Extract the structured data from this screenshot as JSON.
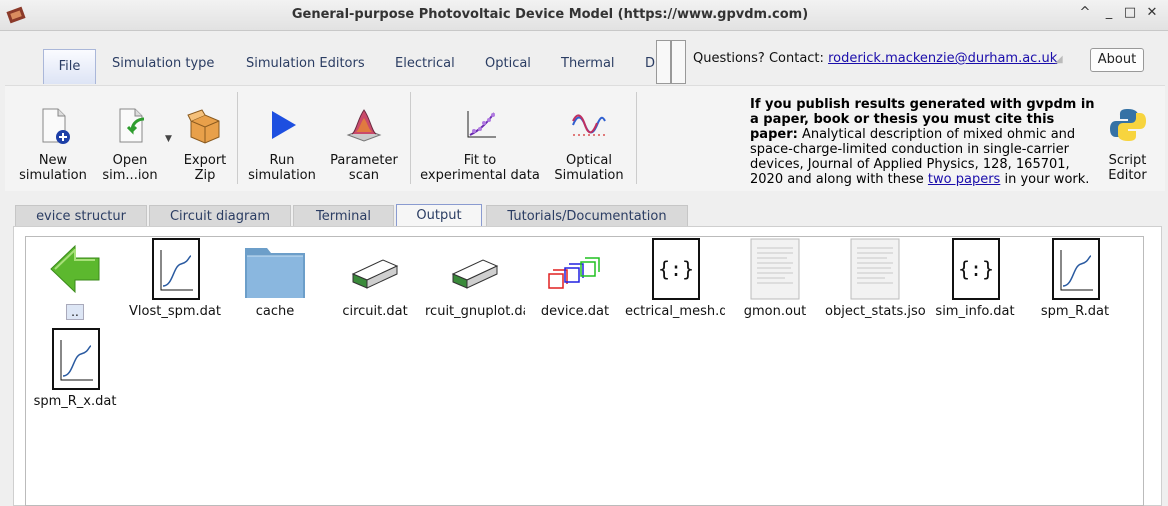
{
  "window": {
    "title": "General-purpose Photovoltaic Device Model (https://www.gpvdm.com)",
    "controls": [
      "^",
      "_",
      "□",
      "✕"
    ]
  },
  "ribbon_tabs": [
    "File",
    "Simulation type",
    "Simulation Editors",
    "Electrical",
    "Optical",
    "Thermal",
    "D"
  ],
  "contact": {
    "prefix": "Questions? Contact:",
    "email": "roderick.mackenzie@durham.ac.uk"
  },
  "about_label": "About",
  "toolbar": {
    "new_sim": [
      "New",
      "simulation"
    ],
    "open_sim": [
      "Open",
      "sim...ion"
    ],
    "export_zip": [
      "Export",
      "Zip"
    ],
    "run_sim": [
      "Run",
      "simulation"
    ],
    "param_scan": [
      "Parameter",
      "scan"
    ],
    "fit": [
      "Fit to",
      "experimental data"
    ],
    "optical_sim": [
      "Optical",
      "Simulation"
    ],
    "script_editor": [
      "Script",
      "Editor"
    ]
  },
  "citation": {
    "bold": "If you publish results generated with gvpdm in a paper, book or thesis you must cite this paper:",
    "text": " Analytical description of mixed ohmic and space-charge-limited conduction in single-carrier devices, Journal of Applied Physics, 128, 165701, 2020 and along with these ",
    "link": "two papers",
    "tail": " in your work."
  },
  "doc_tabs": [
    "evice structur",
    "Circuit diagram",
    "Terminal",
    "Output",
    "Tutorials/Documentation"
  ],
  "files": [
    {
      "name": "..",
      "icon": "back-arrow-icon"
    },
    {
      "name": "Vlost_spm.dat",
      "icon": "plot-file-icon"
    },
    {
      "name": "cache",
      "icon": "folder-icon"
    },
    {
      "name": "circuit.dat",
      "icon": "block-icon"
    },
    {
      "name": "rcuit_gnuplot.da",
      "icon": "block-icon"
    },
    {
      "name": "device.dat",
      "icon": "device-cubes-icon"
    },
    {
      "name": "ectrical_mesh.d",
      "icon": "json-file-icon"
    },
    {
      "name": "gmon.out",
      "icon": "text-file-icon"
    },
    {
      "name": "object_stats.json",
      "icon": "text-file-icon"
    },
    {
      "name": "sim_info.dat",
      "icon": "json-file-icon"
    },
    {
      "name": "spm_R.dat",
      "icon": "plot-file-icon"
    },
    {
      "name": "spm_R_x.dat",
      "icon": "plot-file-icon"
    }
  ]
}
